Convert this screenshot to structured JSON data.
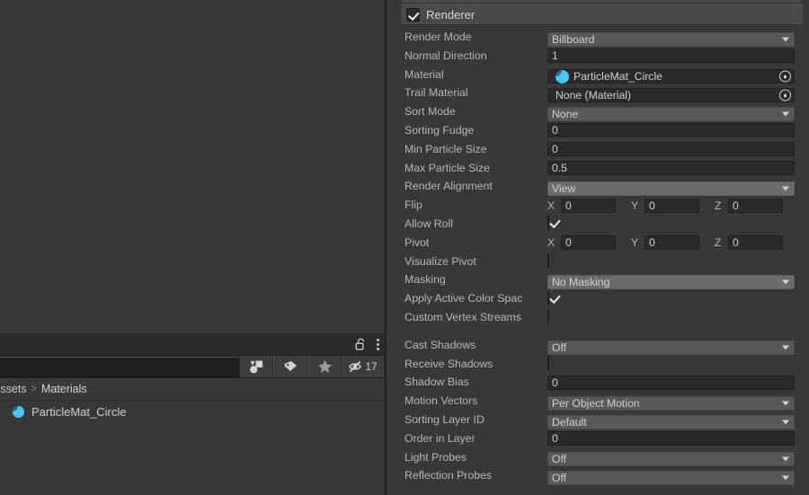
{
  "app": "Unity Editor",
  "inspector": {
    "partial_top_component": "",
    "component": {
      "title": "Renderer",
      "enabled_checkbox": true,
      "icon": "checkbox-checked-icon"
    },
    "groups": [
      {
        "rows": [
          {
            "label": "Render Mode",
            "type": "dropdown",
            "value": "Billboard",
            "hot": false
          },
          {
            "label": "Normal Direction",
            "type": "text",
            "value": "1"
          },
          {
            "label": "Material",
            "type": "object",
            "value": "ParticleMat_Circle",
            "icon": "material-sphere-icon"
          },
          {
            "label": "Trail Material",
            "type": "object",
            "value": "None (Material)",
            "icon": ""
          },
          {
            "label": "Sort Mode",
            "type": "dropdown",
            "value": "None",
            "hot": false
          },
          {
            "label": "Sorting Fudge",
            "type": "text",
            "value": "0"
          },
          {
            "label": "Min Particle Size",
            "type": "text",
            "value": "0"
          },
          {
            "label": "Max Particle Size",
            "type": "text",
            "value": "0.5"
          },
          {
            "label": "Render Alignment",
            "type": "dropdown",
            "value": "View",
            "hot": true
          },
          {
            "label": "Flip",
            "type": "xyz",
            "axes": [
              "X",
              "Y",
              "Z"
            ],
            "values": [
              "0",
              "0",
              "0"
            ]
          },
          {
            "label": "Allow Roll",
            "type": "checkbox",
            "value": true
          },
          {
            "label": "Pivot",
            "type": "xyz",
            "axes": [
              "X",
              "Y",
              "Z"
            ],
            "values": [
              "0",
              "0",
              "0"
            ]
          },
          {
            "label": "Visualize Pivot",
            "type": "checkbox",
            "value": false
          },
          {
            "label": "Masking",
            "type": "dropdown",
            "value": "No Masking",
            "hot": true
          },
          {
            "label": "Apply Active Color Spac",
            "type": "checkbox-inline",
            "value": true
          },
          {
            "label": "Custom Vertex Streams",
            "type": "checkbox-inline",
            "value": false
          }
        ]
      },
      {
        "rows": [
          {
            "label": "Cast Shadows",
            "type": "dropdown",
            "value": "Off",
            "hot": false
          },
          {
            "label": "Receive Shadows",
            "type": "checkbox",
            "value": false
          },
          {
            "label": "Shadow Bias",
            "type": "text",
            "value": "0"
          },
          {
            "label": "Motion Vectors",
            "type": "dropdown",
            "value": "Per Object Motion",
            "hot": false
          },
          {
            "label": "Sorting Layer ID",
            "type": "dropdown",
            "value": "Default",
            "hot": false
          },
          {
            "label": "Order in Layer",
            "type": "text",
            "value": "0"
          },
          {
            "label": "Light Probes",
            "type": "dropdown",
            "value": "Off",
            "hot": false
          },
          {
            "label": "Reflection Probes",
            "type": "dropdown",
            "value": "Off",
            "hot": false
          }
        ]
      }
    ]
  },
  "project_panel": {
    "lock_icon": "padlock-open-icon",
    "menu_icon": "kebab-menu-icon",
    "search": {
      "value": "",
      "placeholder": ""
    },
    "toolbar_buttons": [
      {
        "name": "filter-by-type-icon",
        "label": ""
      },
      {
        "name": "filter-by-label-icon",
        "label": ""
      },
      {
        "name": "favorites-star-icon",
        "label": ""
      },
      {
        "name": "hidden-items-icon",
        "label": "17"
      }
    ],
    "breadcrumb": {
      "root": "Assets",
      "separator": ">",
      "current": "Materials"
    },
    "items": [
      {
        "name": "ParticleMat_Circle",
        "icon": "material-sphere-icon"
      }
    ]
  },
  "colors": {
    "panel_bg": "#383838",
    "header_bg": "#4a4a4a",
    "field_bg": "#2a2a2a",
    "dropdown_bg": "#585858",
    "dropdown_hover_bg": "#6b6b6b",
    "text": "#b6b6b6",
    "value_text": "#cfcfcf",
    "accent_material": "#4fc3f7",
    "divider": "#232323"
  }
}
